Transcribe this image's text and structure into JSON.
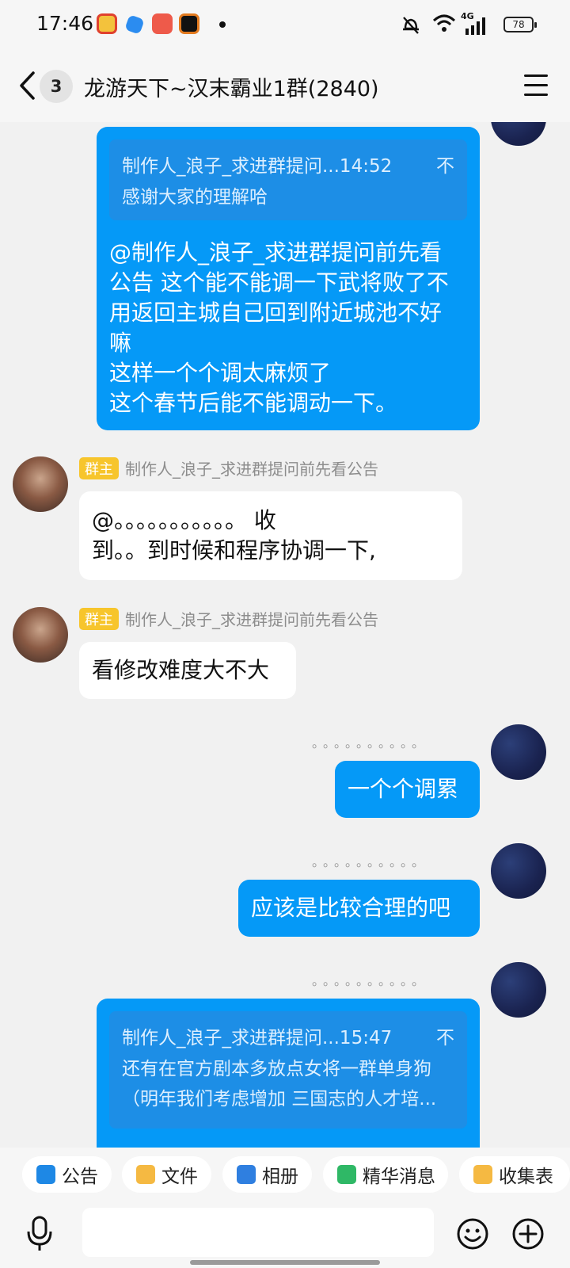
{
  "status_bar": {
    "time": "17:46",
    "network": "4G",
    "battery": "78",
    "icons": [
      "weibo-icon",
      "app-blue-icon",
      "music-icon",
      "app-black-icon",
      "notification-dot",
      "mute-vibrate-icon",
      "wifi-icon",
      "signal-icon",
      "battery-icon"
    ]
  },
  "header": {
    "unread_count": "3",
    "title": "龙游天下~汉末霸业1群(2840)"
  },
  "messages": [
    {
      "quote_author": "制作人_浪子_求进群提问...14:52",
      "quote_close": "不",
      "quote_text": "感谢大家的理解哈",
      "lines": [
        "@制作人_浪子_求进群提问前先看",
        "公告 这个能不能调一下武将败了不",
        "用返回主城自己回到附近城池不好",
        "嘛",
        "这样一个个调太麻烦了",
        "这个春节后能不能调动一下。"
      ]
    },
    {
      "role": "群主",
      "sender": "制作人_浪子_求进群提问前先看公告",
      "lines": [
        "@。。。。。。。。。。。 收",
        "到。。到时候和程序协调一下,"
      ]
    },
    {
      "role": "群主",
      "sender": "制作人_浪子_求进群提问前先看公告",
      "lines": [
        "看修改难度大不大"
      ]
    },
    {
      "sender": "。。。。。。。。。。",
      "text": "一个个调累"
    },
    {
      "sender": "。。。。。。。。。。",
      "text": "应该是比较合理的吧"
    },
    {
      "sender": "。。。。。。。。。。",
      "quote_author": "制作人_浪子_求进群提问...15:47",
      "quote_close": "不",
      "quote_lines": [
        "还有在官方剧本多放点女将一群单身狗",
        "（明年我们考虑增加 三国志的人才培..."
      ]
    }
  ],
  "quick_bar": [
    {
      "label": "公告",
      "icon": "announcement-icon",
      "color": "#1e88e5"
    },
    {
      "label": "文件",
      "icon": "folder-icon",
      "color": "#f5b942"
    },
    {
      "label": "相册",
      "icon": "album-icon",
      "color": "#2f7fe0"
    },
    {
      "label": "精华消息",
      "icon": "highlight-icon",
      "color": "#2fb866"
    },
    {
      "label": "收集表",
      "icon": "form-icon",
      "color": "#f5b942"
    }
  ],
  "input": {
    "value": ""
  }
}
